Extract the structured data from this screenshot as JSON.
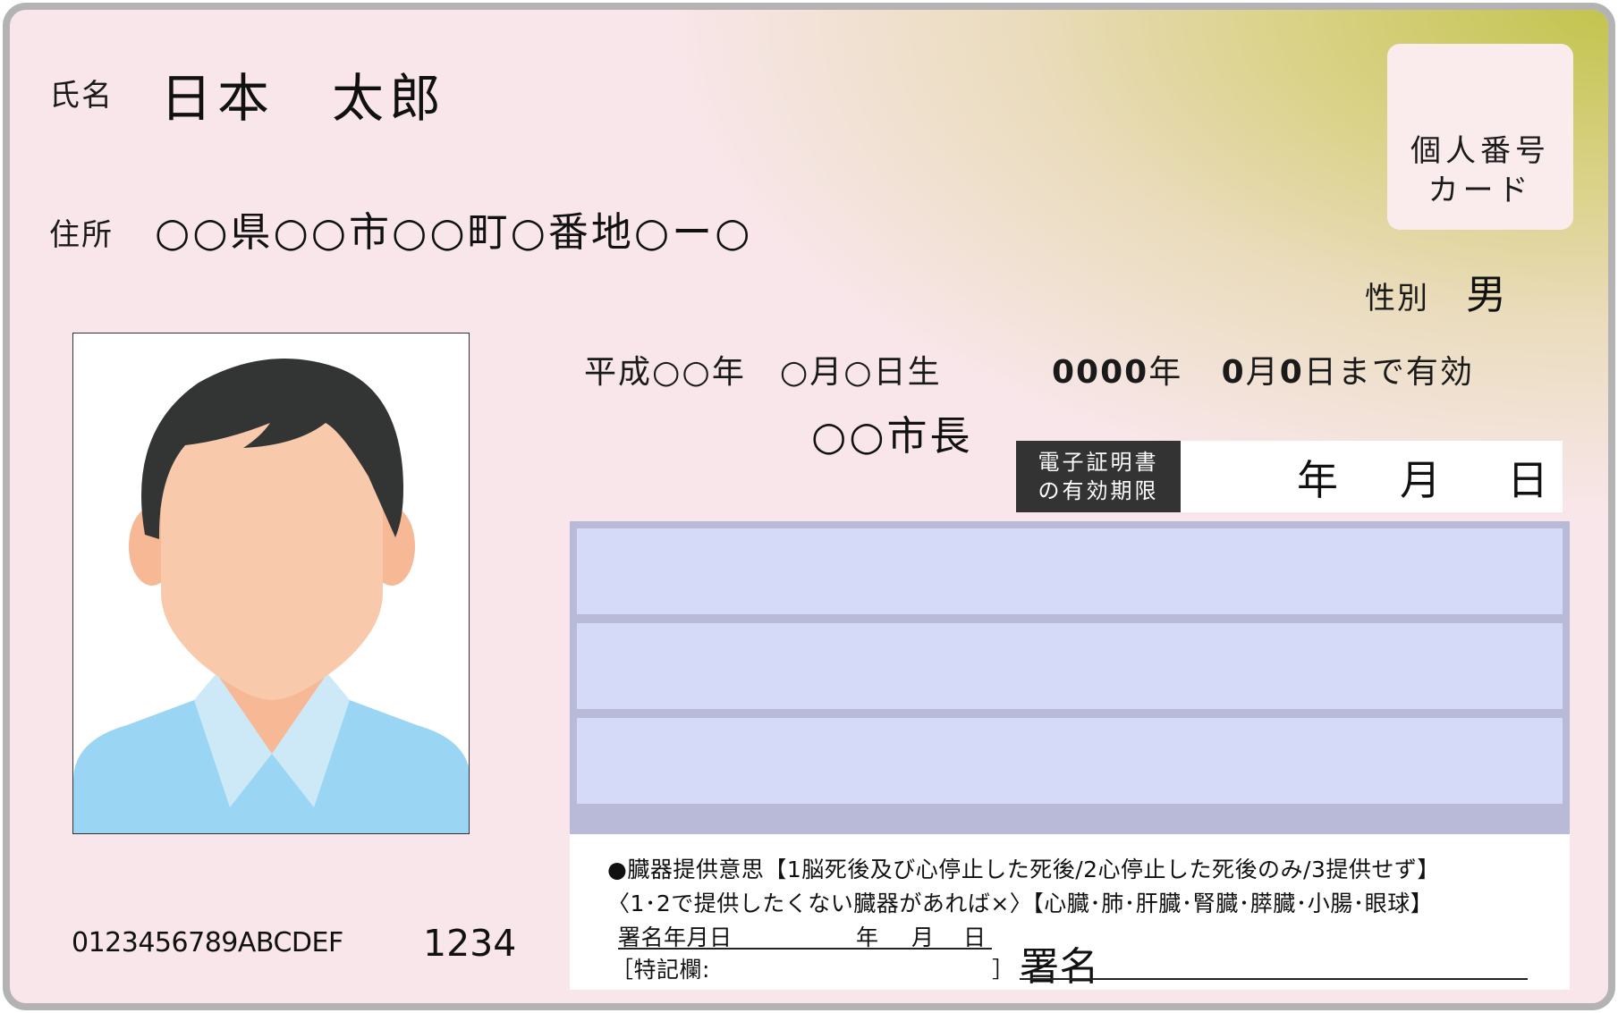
{
  "card": {
    "name_label": "氏名",
    "name_value": "日本　太郎",
    "address_label": "住所",
    "address_value": "○○県○○市○○町○番地○ー○",
    "mynumber_label_line1": "個人番号",
    "mynumber_label_line2": "カード",
    "sex_label": "性別",
    "sex_value": "男",
    "birthdate": "平成○○年　○月○日生",
    "expiry_year": "0000",
    "expiry_year_unit": "年",
    "expiry_month": "0",
    "expiry_month_unit": "月",
    "expiry_day": "0",
    "expiry_suffix": "日まで有効",
    "issuer": "○○市長",
    "cert_label_line1": "電子証明書",
    "cert_label_line2": "の有効期限",
    "cert_year": "年",
    "cert_month": "月",
    "cert_day": "日",
    "serial_number": "0123456789ABCDEF",
    "security_code": "1234"
  },
  "organ": {
    "line1": "●臓器提供意思【1脳死後及び心停止した死後/2心停止した死後のみ/3提供せず】",
    "line2": "〈1･2で提供したくない臓器があれば×〉【心臓･肺･肝臓･腎臓･膵臓･小腸･眼球】",
    "sign_date_label": "署名年月日",
    "sign_date_year": "年",
    "sign_date_month": "月",
    "sign_date_day": "日",
    "remarks_open": "［特記欄:",
    "remarks_close": "］",
    "signature_label": "署名"
  },
  "colors": {
    "card_bg": "#f8e6ea",
    "card_border": "#b3b3b3",
    "gradient_accent": "#c2c44e",
    "notes_fill": "#d4daf7",
    "notes_border": "#b9bad8",
    "label_dark": "#333333"
  },
  "icons": [
    "person-photo-icon"
  ]
}
